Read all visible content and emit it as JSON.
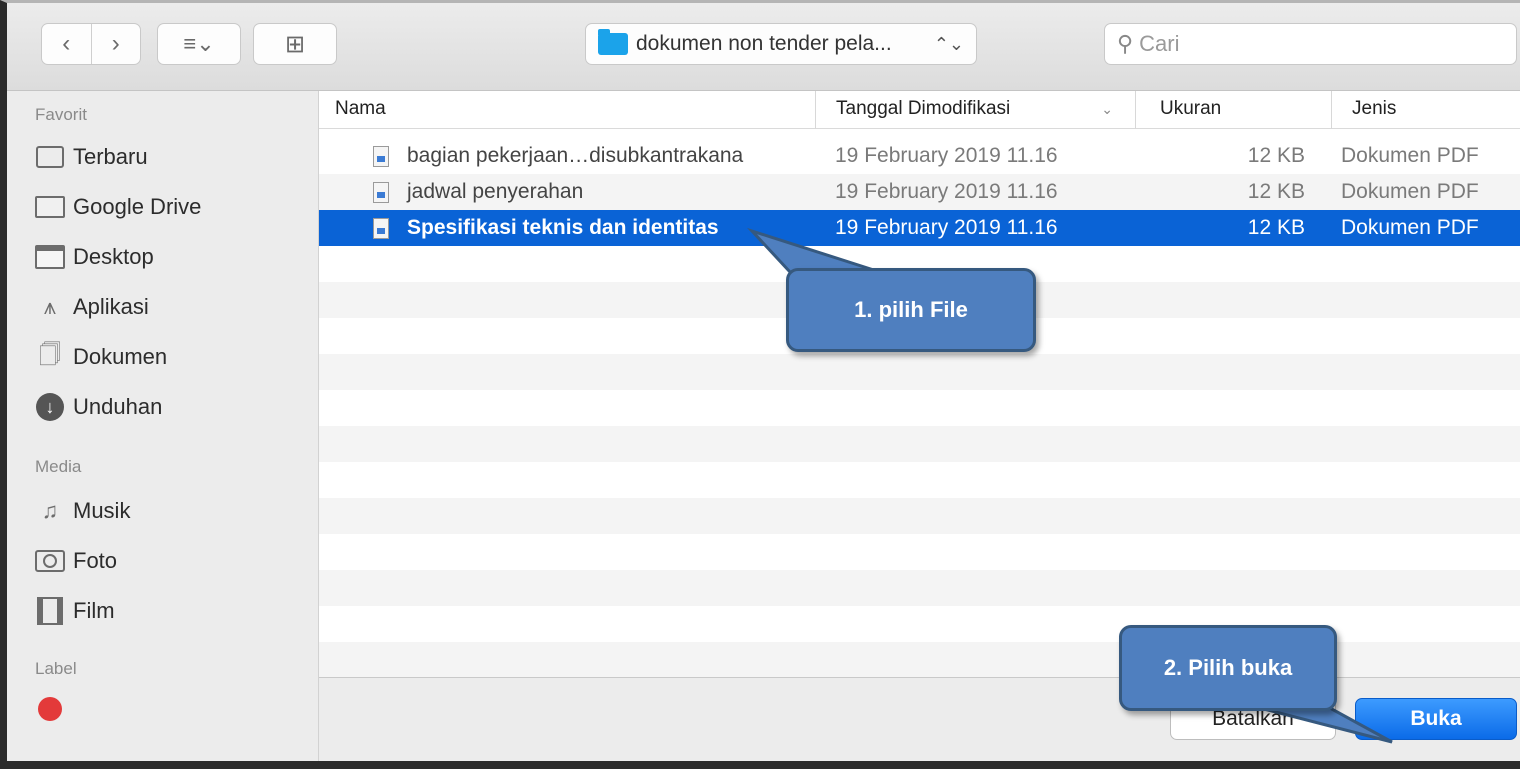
{
  "toolbar": {
    "back_glyph": "‹",
    "forward_glyph": "›",
    "view_glyph": "≡⌄",
    "new_folder_glyph": "⊞",
    "path_label": "dokumen non tender pela...",
    "path_updown": "⌃⌄",
    "search_placeholder": "Cari",
    "icons": {
      "folder": "folder-icon",
      "search": "search-icon"
    }
  },
  "sidebar": {
    "favorites_heading": "Favorit",
    "favorites": [
      {
        "label": "Terbaru",
        "icon": "recent-icon"
      },
      {
        "label": "Google Drive",
        "icon": "folder-icon"
      },
      {
        "label": "Desktop",
        "icon": "desktop-icon"
      },
      {
        "label": "Aplikasi",
        "icon": "applications-icon"
      },
      {
        "label": "Dokumen",
        "icon": "documents-icon"
      },
      {
        "label": "Unduhan",
        "icon": "download-icon"
      }
    ],
    "media_heading": "Media",
    "media": [
      {
        "label": "Musik",
        "icon": "music-icon"
      },
      {
        "label": "Foto",
        "icon": "camera-icon"
      },
      {
        "label": "Film",
        "icon": "film-icon"
      }
    ],
    "label_heading": "Label"
  },
  "columns": {
    "name": "Nama",
    "modified": "Tanggal Dimodifikasi",
    "size": "Ukuran",
    "kind": "Jenis"
  },
  "files": [
    {
      "name": "bagian pekerjaan…disubkantrakana",
      "modified": "19 February 2019 11.16",
      "size": "12 KB",
      "kind": "Dokumen PDF"
    },
    {
      "name": "jadwal penyerahan",
      "modified": "19 February 2019 11.16",
      "size": "12 KB",
      "kind": "Dokumen PDF"
    },
    {
      "name": "Spesifikasi teknis dan identitas",
      "modified": "19 February 2019 11.16",
      "size": "12 KB",
      "kind": "Dokumen PDF",
      "selected": true
    }
  ],
  "footer": {
    "cancel_label": "Batalkan",
    "open_label": "Buka"
  },
  "callouts": {
    "step1": "1. pilih File",
    "step2": "2. Pilih buka"
  },
  "colors": {
    "selection": "#0a63d6",
    "callout_fill": "#4f7fbf",
    "callout_border": "#36597f",
    "open_button": "#0b6be8"
  }
}
